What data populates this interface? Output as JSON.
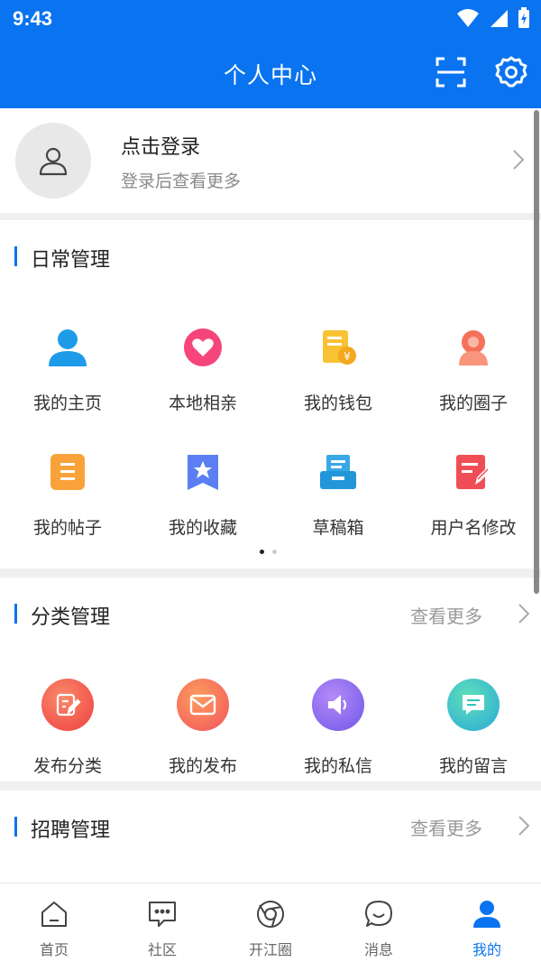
{
  "status": {
    "time": "9:43"
  },
  "header": {
    "title": "个人中心",
    "scan_icon": "scan-icon",
    "settings_icon": "gear-icon"
  },
  "login": {
    "title": "点击登录",
    "subtitle": "登录后查看更多"
  },
  "daily": {
    "title": "日常管理",
    "items": [
      {
        "label": "我的主页",
        "icon": "person-icon",
        "color": "#1e9be8"
      },
      {
        "label": "本地相亲",
        "icon": "heart-icon",
        "color": "#f5457a"
      },
      {
        "label": "我的钱包",
        "icon": "wallet-receipt-icon",
        "color": "#f7c234"
      },
      {
        "label": "我的圈子",
        "icon": "circle-person-icon",
        "color": "#f5715a"
      },
      {
        "label": "我的帖子",
        "icon": "post-icon",
        "color": "#f9a23a"
      },
      {
        "label": "我的收藏",
        "icon": "bookmark-star-icon",
        "color": "#5b7ff2"
      },
      {
        "label": "草稿箱",
        "icon": "draft-box-icon",
        "color": "#2196d8"
      },
      {
        "label": "用户名修改",
        "icon": "edit-doc-icon",
        "color": "#f04e56"
      }
    ]
  },
  "category": {
    "title": "分类管理",
    "more": "查看更多",
    "items": [
      {
        "label": "发布分类",
        "icon": "publish-edit-icon",
        "color": "#f2594b"
      },
      {
        "label": "我的发布",
        "icon": "mail-icon",
        "color": "#f8604f"
      },
      {
        "label": "我的私信",
        "icon": "speaker-icon",
        "color": "#8a5cf0"
      },
      {
        "label": "我的留言",
        "icon": "message-icon",
        "color": "#2fc6b8"
      }
    ]
  },
  "recruit": {
    "title": "招聘管理",
    "more": "查看更多"
  },
  "tabs": [
    {
      "label": "首页",
      "icon": "home-icon"
    },
    {
      "label": "社区",
      "icon": "chat-box-icon"
    },
    {
      "label": "开江圈",
      "icon": "circle-ring-icon"
    },
    {
      "label": "消息",
      "icon": "smile-bubble-icon"
    },
    {
      "label": "我的",
      "icon": "profile-icon",
      "active": true
    }
  ],
  "colors": {
    "primary": "#0a73f0"
  }
}
